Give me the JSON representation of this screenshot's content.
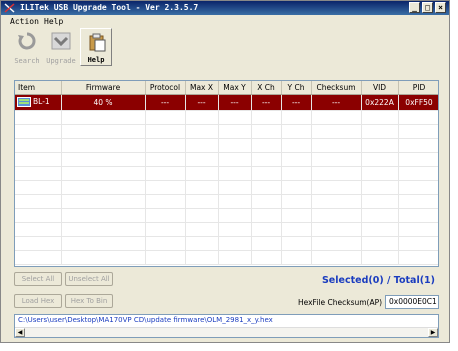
{
  "window": {
    "title": "ILITek USB Upgrade Tool - Ver 2.3.5.7",
    "min_glyph": "_",
    "max_glyph": "□",
    "close_glyph": "×"
  },
  "menu": {
    "action": "Action",
    "help": "Help"
  },
  "toolbar": {
    "search": "Search",
    "upgrade": "Upgrade",
    "help": "Help"
  },
  "columns": [
    "Item",
    "Firmware",
    "Protocol",
    "Max X",
    "Max Y",
    "X Ch",
    "Y Ch",
    "Checksum",
    "VID",
    "PID"
  ],
  "row": {
    "item": "BL-1",
    "firmware": "40 %",
    "protocol": "---",
    "max_x": "---",
    "max_y": "---",
    "x_ch": "---",
    "y_ch": "---",
    "checksum": "---",
    "vid": "0x222A",
    "pid": "0xFF50"
  },
  "buttons": {
    "select_all": "Select All",
    "unselect_all": "Unselect All",
    "load_hex": "Load Hex",
    "hex_to_bin": "Hex To Bin"
  },
  "status": "Selected(0) / Total(1)",
  "checksum": {
    "label": "HexFile Checksum(AP) :",
    "value": "0x0000E0C1"
  },
  "path": "C:\\Users\\user\\Desktop\\MA170VP CD\\update firmware\\OLM_2981_x_y.hex",
  "colors": {
    "selected_row": "#8b0000",
    "status_text": "#1a3cbf",
    "titlebar": "#0a246a"
  }
}
